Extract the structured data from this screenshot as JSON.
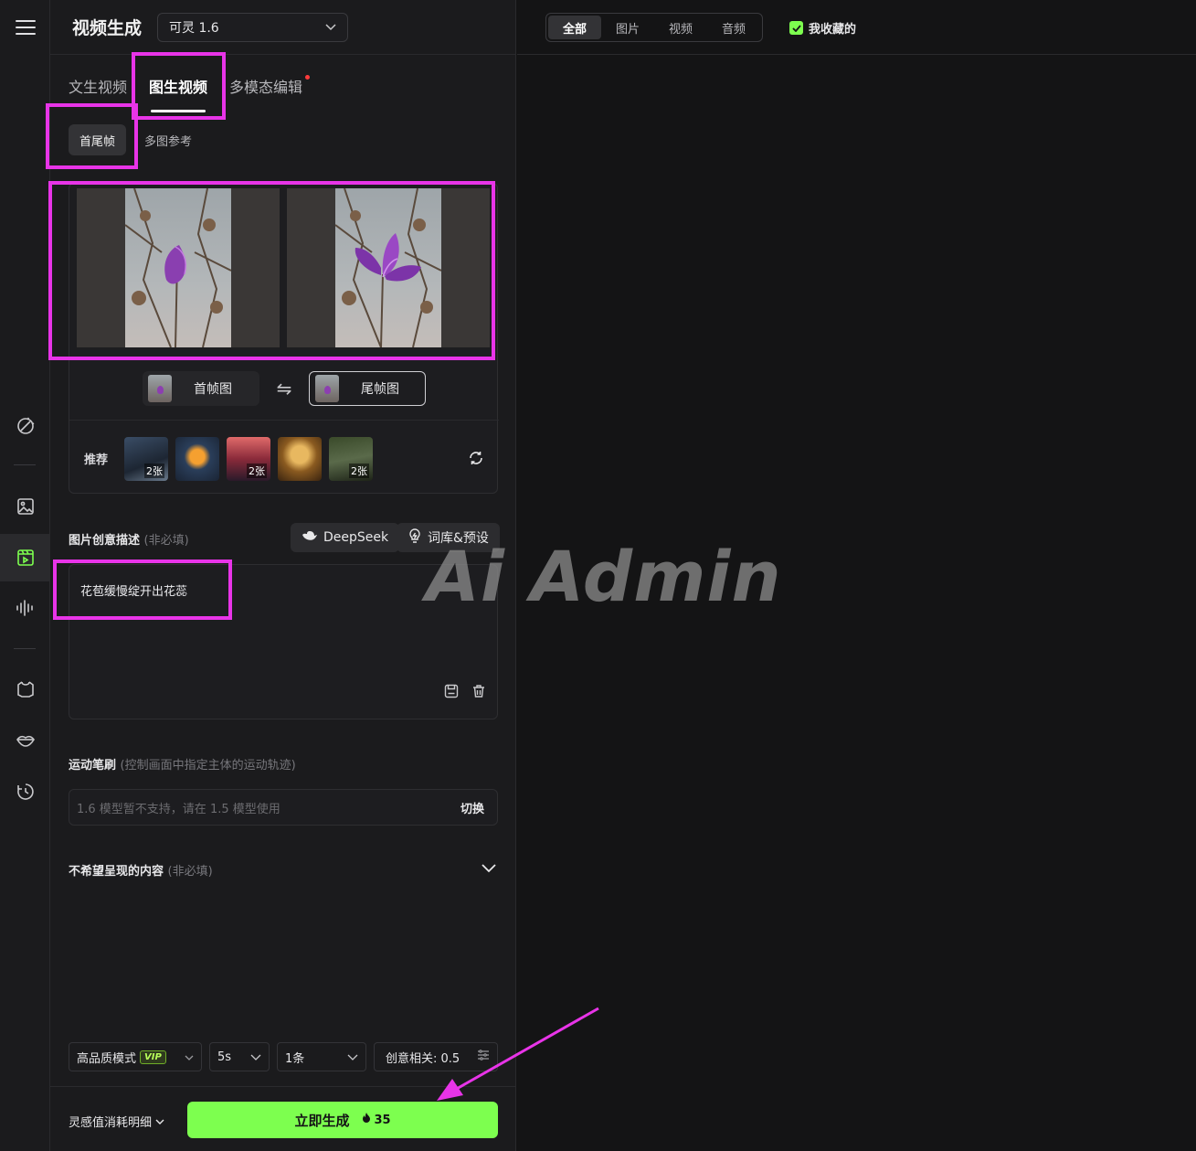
{
  "header": {
    "title": "视频生成",
    "model": "可灵 1.6"
  },
  "tabs": [
    {
      "label": "文生视频"
    },
    {
      "label": "图生视频"
    },
    {
      "label": "多模态编辑"
    }
  ],
  "subtabs": [
    {
      "label": "首尾帧"
    },
    {
      "label": "多图参考"
    }
  ],
  "frames": {
    "first_label": "首帧图",
    "last_label": "尾帧图"
  },
  "recommend": {
    "label": "推荐",
    "items": [
      {
        "count": "2张"
      },
      {
        "count": ""
      },
      {
        "count": "2张"
      },
      {
        "count": ""
      },
      {
        "count": "2张"
      }
    ]
  },
  "prompt_section": {
    "label": "图片创意描述",
    "optional": "(非必填)",
    "deepseek": "DeepSeek",
    "library": "词库&预设",
    "text": "花苞缓慢绽开出花蕊"
  },
  "brush_section": {
    "label": "运动笔刷",
    "hint": "(控制画面中指定主体的运动轨迹)",
    "placeholder": "1.6 模型暂不支持，请在 1.5 模型使用",
    "switch_label": "切换"
  },
  "negative_section": {
    "label": "不希望呈现的内容",
    "optional": "(非必填)"
  },
  "options": {
    "quality": "高品质模式",
    "vip": "VIP",
    "duration": "5s",
    "count": "1条",
    "creativity": "创意相关: 0.5"
  },
  "footer": {
    "cost_detail": "灵感值消耗明细",
    "generate": "立即生成",
    "cost": "35"
  },
  "right": {
    "filters": [
      {
        "label": "全部"
      },
      {
        "label": "图片"
      },
      {
        "label": "视频"
      },
      {
        "label": "音频"
      }
    ],
    "favorites": "我收藏的"
  },
  "watermark": "Ai Admin",
  "colors": {
    "accent": "#7dff4f",
    "highlight": "#e834e8",
    "background": "#141415",
    "panel": "#1b1b1d"
  }
}
